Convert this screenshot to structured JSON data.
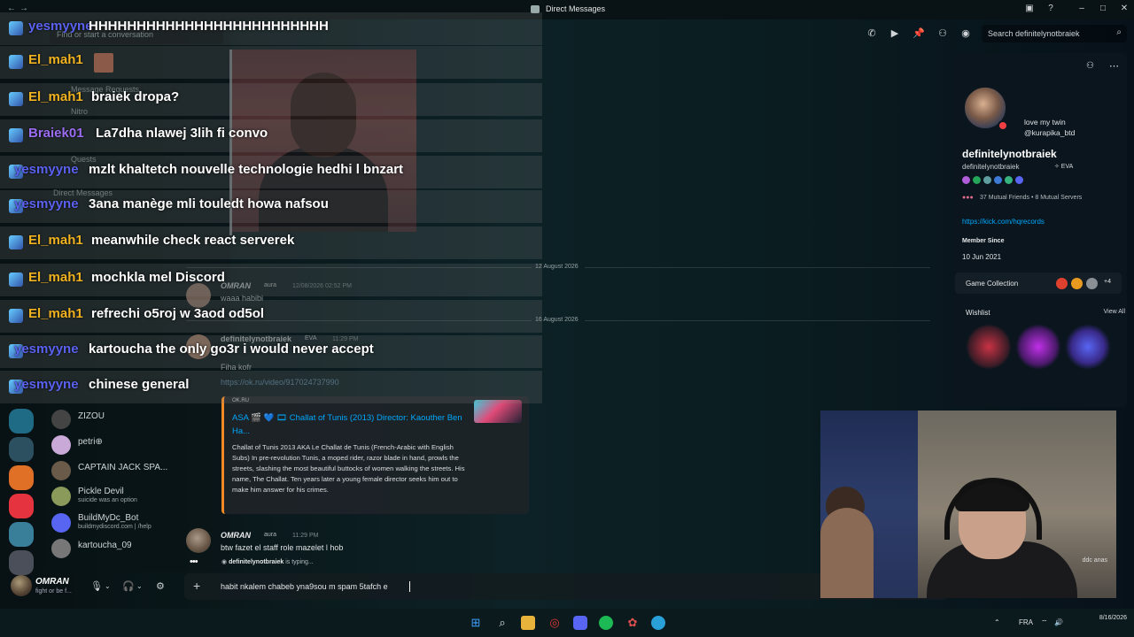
{
  "window": {
    "title": "Direct Messages"
  },
  "sidebar": {
    "search_placeholder": "Find or start a conversation",
    "faint_nav": [
      "Message Requests",
      "Nitro",
      "Quests",
      "Direct Messages"
    ],
    "dms": [
      {
        "name": "ZIZOU",
        "sub": ""
      },
      {
        "name": "petri⊕",
        "sub": ""
      },
      {
        "name": "CAPTAIN JACK SPA...",
        "sub": ""
      },
      {
        "name": "Pickle Devil",
        "sub": "suicide was an option"
      },
      {
        "name": "BuildMyDc_Bot",
        "sub": "buildmydiscord.com | /help"
      },
      {
        "name": "kartoucha_09",
        "sub": ""
      }
    ]
  },
  "user_panel": {
    "name": "OMRAN",
    "status": "fight or be f..."
  },
  "header": {
    "dm_name": "definitelynotbraiek",
    "dm_status": "love my twin @kurapika_btd",
    "search_placeholder": "Search definitelynotbraiek"
  },
  "messages": {
    "date1": "12 August 2026",
    "date2": "16 August 2026",
    "m1": {
      "author": "OMRAN",
      "tag": "aura",
      "time": "12/08/2026 02:52 PM",
      "text": "waaa habibi"
    },
    "m2": {
      "author": "definitelynotbraiek",
      "tag": "EVA",
      "time": "11:29 PM",
      "text": "Fiha kofr",
      "link": "https://ok.ru/video/917024737990"
    },
    "embed": {
      "source": "OK.RU",
      "title": "ASA 🎬 💙 🎞 Challat of Tunis (2013) Director: Kaouther Ben Ha...",
      "description": "Challat of Tunis 2013 AKA Le Challat de Tunis (French-Arabic with English Subs) In pre-revolution Tunis, a moped rider, razor blade in hand, prowls the streets, slashing the most beautiful buttocks of women walking the streets. His name, The Challat. Ten years later a young female director seeks him out to make him answer for his crimes."
    },
    "m3": {
      "author": "OMRAN",
      "tag": "aura",
      "time": "11:29 PM",
      "text": "btw fazet el staff role mazelet l hob"
    },
    "typing_user": "definitelynotbraiek",
    "typing_suffix": " is typing..."
  },
  "composer": {
    "value": "habit nkalem chabeb yna9sou m spam 5tafch e"
  },
  "profile": {
    "status": "love my twin @kurapika_btd",
    "display_name": "definitelynotbraiek",
    "username": "definitelynotbraiek",
    "tag": "✧ EVA",
    "mutual": "37 Mutual Friends • 8 Mutual Servers",
    "link": "https://kick.com/hqrecords",
    "member_since_label": "Member Since",
    "member_since": "10 Jun 2021",
    "game_collection": "Game Collection",
    "game_more": "+4",
    "wishlist": "Wishlist",
    "view_all": "View All"
  },
  "webcam": {
    "watermark": "ddc anas"
  },
  "overlay_chat": [
    {
      "user": "yesmyyne",
      "color": "y",
      "text": "HHHHHHHHHHHHHHHHHHHHHHHHH"
    },
    {
      "user": "El_mah1",
      "color": "e",
      "text": ""
    },
    {
      "user": "El_mah1",
      "color": "e",
      "text": "braiek dropa?"
    },
    {
      "user": "Braiek01",
      "color": "b",
      "text": "La7dha nlawej 3lih fi convo"
    },
    {
      "user": "yesmyyne",
      "color": "y",
      "text": "mzlt khaltetch nouvelle technologie hedhi l bnzart"
    },
    {
      "user": "yesmyyne",
      "color": "y",
      "text": "3ana manège mli touledt howa nafsou"
    },
    {
      "user": "El_mah1",
      "color": "e",
      "text": "meanwhile check react serverek"
    },
    {
      "user": "El_mah1",
      "color": "e",
      "text": "mochkla mel Discord"
    },
    {
      "user": "El_mah1",
      "color": "e",
      "text": "refrechi o5roj w 3aod od5ol"
    },
    {
      "user": "yesmyyne",
      "color": "y",
      "text": "kartoucha the only go3r i would never accept"
    },
    {
      "user": "yesmyyne",
      "color": "y",
      "text": "chinese general"
    }
  ],
  "taskbar": {
    "lang": "FRA",
    "time": "",
    "date": "8/16/2026"
  }
}
